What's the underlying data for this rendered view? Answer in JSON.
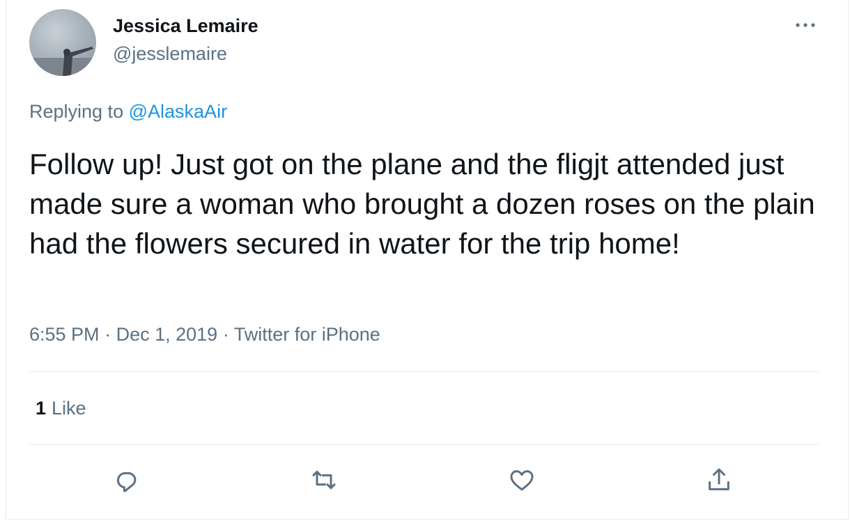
{
  "tweet": {
    "author_name": "Jessica Lemaire",
    "author_handle": "@jesslemaire",
    "more_icon": "more-horizontal-icon",
    "replying_prefix": "Replying to",
    "replying_to": "@AlaskaAir",
    "text": "Follow up! Just got on the plane and the fligjt attended just made sure a woman who brought a dozen roses on the plain had the flowers secured in water for the trip home!",
    "time": "6:55 PM",
    "separator": "·",
    "date": "Dec 1, 2019",
    "source": "Twitter for iPhone",
    "like_count": "1",
    "like_label": "Like"
  },
  "actions": [
    {
      "name": "reply",
      "icon": "reply-icon"
    },
    {
      "name": "retweet",
      "icon": "retweet-icon"
    },
    {
      "name": "like",
      "icon": "heart-icon"
    },
    {
      "name": "share",
      "icon": "share-icon"
    }
  ],
  "colors": {
    "text_primary": "#0f1419",
    "text_secondary": "#5b7083",
    "link": "#1b95e0",
    "divider": "#e6ecf0"
  }
}
